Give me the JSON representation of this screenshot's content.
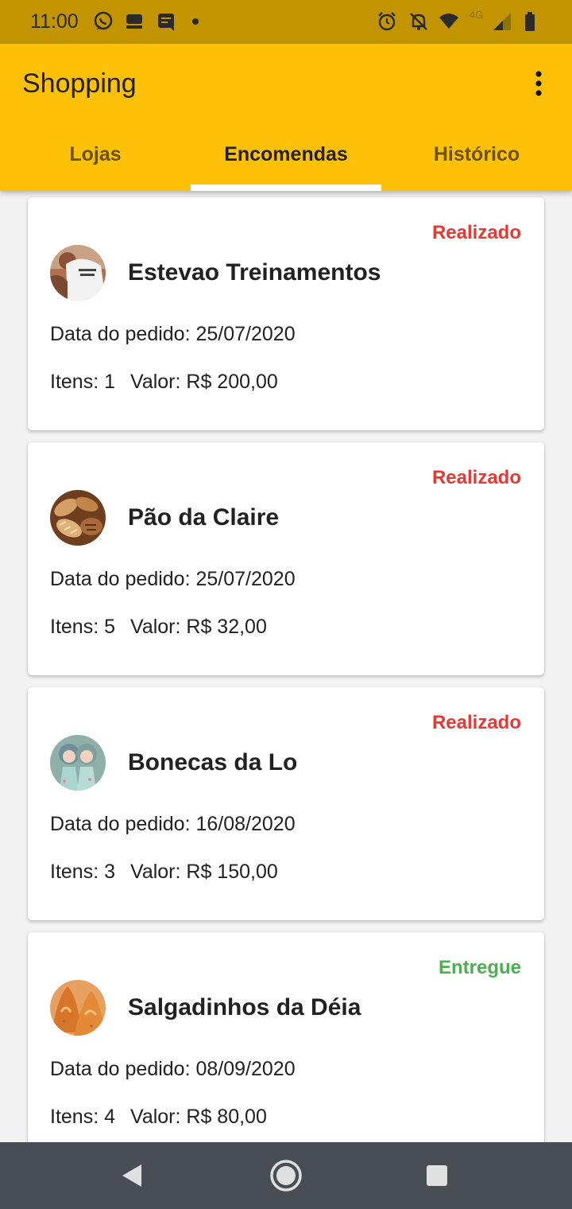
{
  "status_bar": {
    "time": "11:00",
    "network": "4G",
    "icons": [
      "whatsapp-icon",
      "stack-icon",
      "message-icon",
      "dot-icon",
      "alarm-icon",
      "notifications-off-icon",
      "wifi-icon",
      "signal-icon",
      "battery-icon"
    ]
  },
  "app_bar": {
    "title": "Shopping",
    "menu_icon": "more-vert-icon"
  },
  "tabs": [
    {
      "label": "Lojas",
      "active": false
    },
    {
      "label": "Encomendas",
      "active": true
    },
    {
      "label": "Histórico",
      "active": false
    }
  ],
  "colors": {
    "status_bar": "#c29400",
    "app_bar": "#ffc107",
    "status_realizado": "#e53935",
    "status_entregue": "#4caf50",
    "nav_bar": "#484e54"
  },
  "orders": [
    {
      "status": "Realizado",
      "store": "Estevao Treinamentos",
      "avatar": "personal-trainer-photo",
      "date_label": "Data do pedido: 25/07/2020",
      "items_label": "Itens: 1",
      "value_label": "Valor: R$ 200,00"
    },
    {
      "status": "Realizado",
      "store": "Pão da Claire",
      "avatar": "bread-photo",
      "date_label": "Data do pedido: 25/07/2020",
      "items_label": "Itens: 5",
      "value_label": "Valor: R$ 32,00"
    },
    {
      "status": "Realizado",
      "store": "Bonecas da Lo",
      "avatar": "dolls-photo",
      "date_label": "Data do pedido: 16/08/2020",
      "items_label": "Itens: 3",
      "value_label": "Valor: R$ 150,00"
    },
    {
      "status": "Entregue",
      "store": "Salgadinhos da Déia",
      "avatar": "coxinha-photo",
      "date_label": "Data do pedido: 08/09/2020",
      "items_label": "Itens: 4",
      "value_label": "Valor: R$ 80,00"
    }
  ],
  "nav_bar": {
    "buttons": [
      "back-icon",
      "home-icon",
      "recents-icon"
    ]
  }
}
